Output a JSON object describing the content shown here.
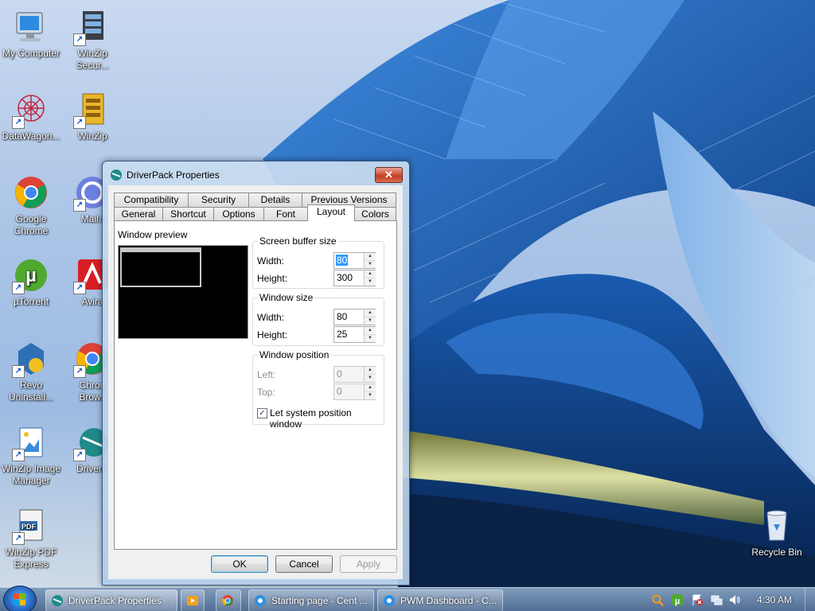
{
  "desktop": {
    "icons": [
      {
        "label": "My Computer"
      },
      {
        "label": "WinZip\nSecur..."
      },
      {
        "label": "DataWagon..."
      },
      {
        "label": "WinZip"
      },
      {
        "label": "Google\nChrome"
      },
      {
        "label": "Mail.t"
      },
      {
        "label": "µTorrent"
      },
      {
        "label": "Avira"
      },
      {
        "label": "Revo\nUninstall..."
      },
      {
        "label": "Chron\nBrows"
      },
      {
        "label": "WinZip Image\nManager"
      },
      {
        "label": "DriverP"
      },
      {
        "label": "WinZip PDF\nExpress"
      },
      {
        "label": "Recycle Bin"
      }
    ]
  },
  "dialog": {
    "title": "DriverPack Properties",
    "close_glyph": "✕",
    "tabs_row1": [
      "Compatibility",
      "Security",
      "Details",
      "Previous Versions"
    ],
    "tabs_row2": [
      "General",
      "Shortcut",
      "Options",
      "Font",
      "Layout",
      "Colors"
    ],
    "active_tab": "Layout",
    "preview_label": "Window preview",
    "screen_buffer": {
      "title": "Screen buffer size",
      "width_label": "Width:",
      "width": "80",
      "height_label": "Height:",
      "height": "300"
    },
    "window_size": {
      "title": "Window size",
      "width_label": "Width:",
      "width": "80",
      "height_label": "Height:",
      "height": "25"
    },
    "window_position": {
      "title": "Window position",
      "left_label": "Left:",
      "left": "0",
      "top_label": "Top:",
      "top": "0"
    },
    "let_system_label": "Let system position window",
    "let_system_checked": true,
    "buttons": {
      "ok": "OK",
      "cancel": "Cancel",
      "apply": "Apply"
    }
  },
  "taskbar": {
    "items": [
      {
        "label": "DriverPack Properties",
        "active": true
      },
      {
        "label": "Starting page - Cent ...",
        "active": false
      },
      {
        "label": "PWM Dashboard - C...",
        "active": false
      }
    ],
    "clock": "4:30 AM"
  },
  "colors": {
    "accent": "#3399ff",
    "taskbar": "#4f6f96",
    "close": "#c94a32"
  }
}
